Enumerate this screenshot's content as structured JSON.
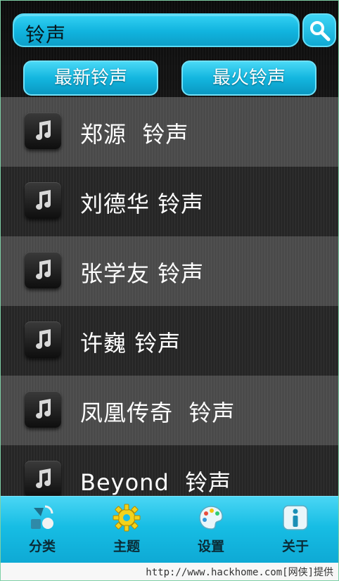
{
  "search": {
    "value": "铃声"
  },
  "buttons": {
    "newest": "最新铃声",
    "hottest": "最火铃声"
  },
  "list": [
    {
      "label": "郑源  铃声",
      "icon": "music-note-icon"
    },
    {
      "label": "刘德华 铃声",
      "icon": "music-note-icon"
    },
    {
      "label": "张学友 铃声",
      "icon": "music-note-icon"
    },
    {
      "label": "许巍 铃声",
      "icon": "music-note-icon"
    },
    {
      "label": "凤凰传奇  铃声",
      "icon": "music-note-icon"
    },
    {
      "label": "Beyond  铃声",
      "icon": "music-note-icon"
    }
  ],
  "tabs": [
    {
      "label": "分类",
      "icon": "category-icon"
    },
    {
      "label": "主题",
      "icon": "gear-icon"
    },
    {
      "label": "设置",
      "icon": "palette-icon"
    },
    {
      "label": "关于",
      "icon": "info-icon"
    }
  ],
  "watermark": "http://www.hackhome.com[网侠]提供",
  "colors": {
    "accent": "#17bde4",
    "row_light": "#4a4a4a",
    "row_dark": "#262626"
  }
}
